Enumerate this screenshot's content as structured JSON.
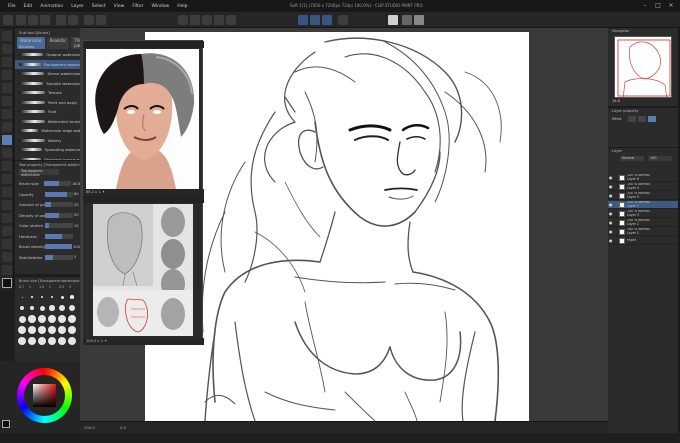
{
  "window": {
    "title": "Soft 1(1) (7000 x 7200px 72dpi 100.0%) - CLIP STUDIO PAINT PRO",
    "controls": [
      "–",
      "□",
      "×"
    ]
  },
  "menu": [
    "File",
    "Edit",
    "Animation",
    "Layer",
    "Select",
    "View",
    "Filter",
    "Window",
    "Help"
  ],
  "subtool": {
    "title": "Sub tool [Brush]",
    "tabs": [
      "Watercolor",
      "Realistic",
      "Thick paint"
    ],
    "group_label": "Brushes",
    "brushes": [
      {
        "name": "Opaque watercolor",
        "selected": false
      },
      {
        "name": "Transparent watercolor",
        "selected": true
      },
      {
        "name": "Dense watercolor",
        "selected": false
      },
      {
        "name": "Smooth watercolor",
        "selected": false
      },
      {
        "name": "Texture",
        "selected": false
      },
      {
        "name": "Paint and apply",
        "selected": false
      },
      {
        "name": "Flatt",
        "selected": false
      },
      {
        "name": "Watercolor brush",
        "selected": false
      },
      {
        "name": "Watercolor edge watercolor",
        "selected": false
      },
      {
        "name": "Watery",
        "selected": false
      },
      {
        "name": "Spreading watercolor",
        "selected": false
      },
      {
        "name": "Streaked coarse wash",
        "selected": false
      },
      {
        "name": "Soothing watercolor",
        "selected": false
      },
      {
        "name": "Rustic paper",
        "selected": false
      }
    ]
  },
  "tool_property": {
    "title": "Tool property [Transparent watercolor]",
    "tool_name": "Transparent watercolor",
    "props": [
      {
        "label": "Brush size",
        "value": "16.8",
        "fill": 0.55
      },
      {
        "label": "Opacity",
        "value": "80",
        "fill": 0.8
      },
      {
        "label": "Amount of paint",
        "value": "20",
        "fill": 0.2
      },
      {
        "label": "Density of paint",
        "value": "50",
        "fill": 0.5
      },
      {
        "label": "Color stretch",
        "value": "15",
        "fill": 0.15
      },
      {
        "label": "Hardness",
        "value": "",
        "fill": 0.6
      },
      {
        "label": "Brush density",
        "value": "100",
        "fill": 1.0
      },
      {
        "label": "Stabilization",
        "value": "3",
        "fill": 0.3
      }
    ]
  },
  "brush_size": {
    "title": "Brush size [Transparent watercolor]",
    "top_numbers": [
      "0.7",
      "1",
      "1.5",
      "2",
      "2.5",
      "3"
    ]
  },
  "reference": {
    "bar1_text": "88.2 ⌂ 1 ✦",
    "bar2_text": "100.0 ⌂ 1 ✦"
  },
  "status": {
    "zoom": "100.0",
    "angle": "0.0"
  },
  "navigator": {
    "title": "Navigator",
    "zoom": "16.6"
  },
  "layer_property": {
    "title": "Layer property",
    "label": "Effect"
  },
  "layers": {
    "title": "Layer",
    "blend": "Normal",
    "opacity": "100",
    "items": [
      {
        "name": "100 % Normal\nLayer 6",
        "selected": false,
        "visible": true
      },
      {
        "name": "100 % Normal\nLayer 4",
        "selected": false,
        "visible": true
      },
      {
        "name": "100 % Normal\nLayer 5",
        "selected": false,
        "visible": true
      },
      {
        "name": "100 % Normal\nLayer 7",
        "selected": true,
        "visible": true
      },
      {
        "name": "100 % Normal\nLayer 3",
        "selected": false,
        "visible": true
      },
      {
        "name": "100 % Normal\nLayer 2",
        "selected": false,
        "visible": true
      },
      {
        "name": "100 % Normal\nLayer 1",
        "selected": false,
        "visible": true
      },
      {
        "name": "Paper",
        "selected": false,
        "visible": true
      }
    ]
  },
  "colors": {
    "accent": "#5a7fb5",
    "selection": "#3d5a85",
    "panel": "#2b2b2b",
    "canvas_bg": "#3a3a3a",
    "main_color": "#111111"
  }
}
